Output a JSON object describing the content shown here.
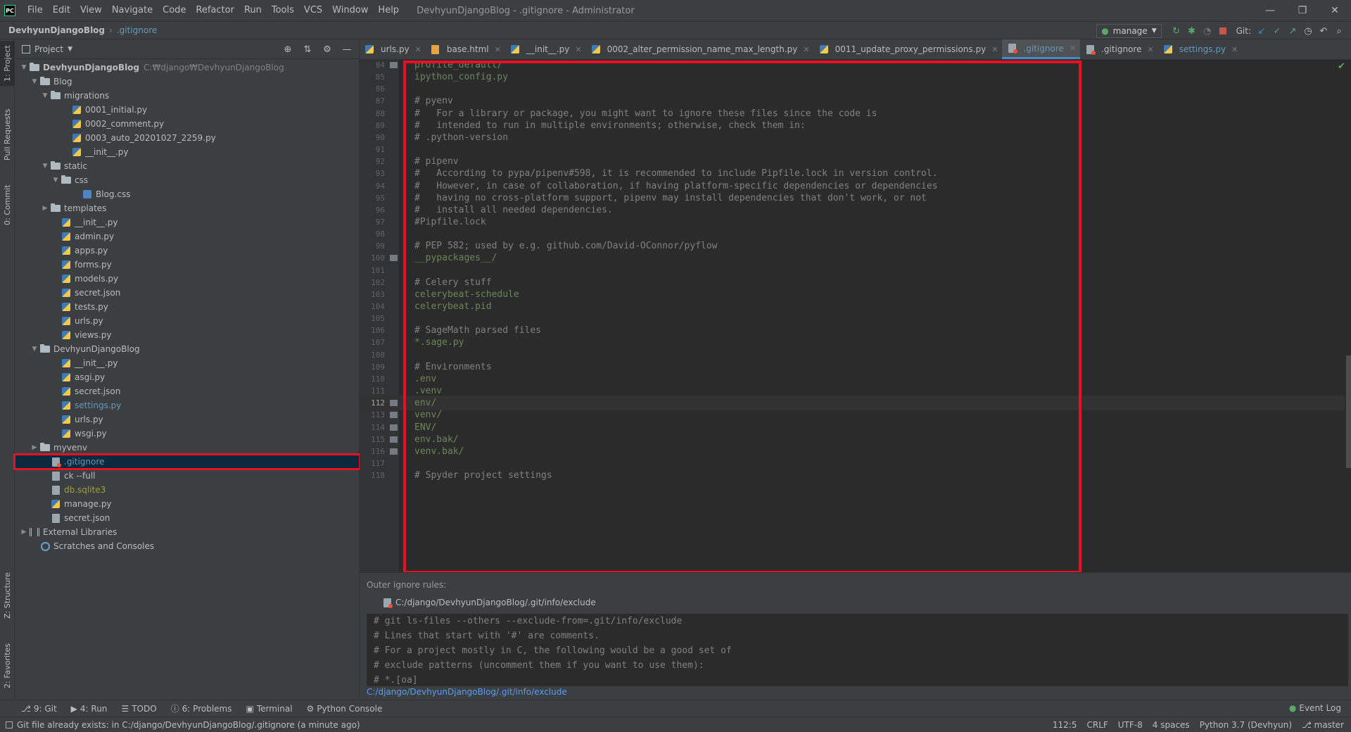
{
  "window": {
    "title": "DevhyunDjangoBlog - .gitignore - Administrator",
    "logo": "PC",
    "menu": [
      "File",
      "Edit",
      "View",
      "Navigate",
      "Code",
      "Refactor",
      "Run",
      "Tools",
      "VCS",
      "Window",
      "Help"
    ],
    "controls": {
      "minimize": "—",
      "restore": "❐",
      "close": "✕"
    }
  },
  "navbar": {
    "root": "DevhyunDjangoBlog",
    "file": ".gitignore",
    "run_config": "manage",
    "git_label": "Git:"
  },
  "left_strip": {
    "tabs": [
      "1: Project",
      "Pull Requests",
      "0: Commit",
      "Z: Structure",
      "2: Favorites"
    ]
  },
  "project_panel": {
    "title": "Project",
    "tree": [
      {
        "label": "DevhyunDjangoBlog",
        "path": "C:₩django₩DevhyunDjangoBlog",
        "kind": "folder",
        "depth": 0,
        "arrow": "▼",
        "style": "bold"
      },
      {
        "label": "Blog",
        "kind": "folder",
        "depth": 1,
        "arrow": "▼"
      },
      {
        "label": "migrations",
        "kind": "folder",
        "depth": 2,
        "arrow": "▼"
      },
      {
        "label": "0001_initial.py",
        "kind": "py",
        "depth": 4
      },
      {
        "label": "0002_comment.py",
        "kind": "py",
        "depth": 4
      },
      {
        "label": "0003_auto_20201027_2259.py",
        "kind": "py",
        "depth": 4
      },
      {
        "label": "__init__.py",
        "kind": "py",
        "depth": 4
      },
      {
        "label": "static",
        "kind": "folder",
        "depth": 2,
        "arrow": "▼"
      },
      {
        "label": "css",
        "kind": "folder",
        "depth": 3,
        "arrow": "▼"
      },
      {
        "label": "Blog.css",
        "kind": "css",
        "depth": 5
      },
      {
        "label": "templates",
        "kind": "folder",
        "depth": 2,
        "arrow": "▶"
      },
      {
        "label": "__init__.py",
        "kind": "py",
        "depth": 3
      },
      {
        "label": "admin.py",
        "kind": "py",
        "depth": 3
      },
      {
        "label": "apps.py",
        "kind": "py",
        "depth": 3
      },
      {
        "label": "forms.py",
        "kind": "py",
        "depth": 3
      },
      {
        "label": "models.py",
        "kind": "py",
        "depth": 3
      },
      {
        "label": "secret.json",
        "kind": "py",
        "depth": 3
      },
      {
        "label": "tests.py",
        "kind": "py",
        "depth": 3
      },
      {
        "label": "urls.py",
        "kind": "py",
        "depth": 3
      },
      {
        "label": "views.py",
        "kind": "py",
        "depth": 3
      },
      {
        "label": "DevhyunDjangoBlog",
        "kind": "folder",
        "depth": 1,
        "arrow": "▼"
      },
      {
        "label": "__init__.py",
        "kind": "py",
        "depth": 3
      },
      {
        "label": "asgi.py",
        "kind": "py",
        "depth": 3
      },
      {
        "label": "secret.json",
        "kind": "py",
        "depth": 3
      },
      {
        "label": "settings.py",
        "kind": "py",
        "depth": 3,
        "style": "blue"
      },
      {
        "label": "urls.py",
        "kind": "py",
        "depth": 3
      },
      {
        "label": "wsgi.py",
        "kind": "py",
        "depth": 3
      },
      {
        "label": "myvenv",
        "kind": "folder",
        "depth": 1,
        "arrow": "▶"
      },
      {
        "label": ".gitignore",
        "kind": "git",
        "depth": 2,
        "selected": true,
        "style": "blue"
      },
      {
        "label": "ck --full",
        "kind": "file",
        "depth": 2
      },
      {
        "label": "db.sqlite3",
        "kind": "file",
        "depth": 2,
        "style": "olive"
      },
      {
        "label": "manage.py",
        "kind": "py",
        "depth": 2
      },
      {
        "label": "secret.json",
        "kind": "file",
        "depth": 2
      },
      {
        "label": "External Libraries",
        "kind": "lib",
        "depth": 0,
        "arrow": "▶"
      },
      {
        "label": "Scratches and Consoles",
        "kind": "scratch",
        "depth": 1
      }
    ]
  },
  "tabs": [
    {
      "label": "urls.py",
      "icon": "py"
    },
    {
      "label": "base.html",
      "icon": "html"
    },
    {
      "label": "__init__.py",
      "icon": "py"
    },
    {
      "label": "0002_alter_permission_name_max_length.py",
      "icon": "py"
    },
    {
      "label": "0011_update_proxy_permissions.py",
      "icon": "py"
    },
    {
      "label": ".gitignore",
      "icon": "git",
      "active": true,
      "style": "blue"
    },
    {
      "label": ".gitignore",
      "icon": "git"
    },
    {
      "label": "settings.py",
      "icon": "py",
      "style": "blue"
    }
  ],
  "editor": {
    "cursor_line": "112",
    "lines": [
      {
        "n": "84",
        "text": "profile_default/",
        "kind": "path",
        "fold": true
      },
      {
        "n": "85",
        "text": "ipython_config.py",
        "kind": "path"
      },
      {
        "n": "86",
        "text": "",
        "kind": "path"
      },
      {
        "n": "87",
        "text": "# pyenv",
        "kind": "comment"
      },
      {
        "n": "88",
        "text": "#   For a library or package, you might want to ignore these files since the code is",
        "kind": "comment"
      },
      {
        "n": "89",
        "text": "#   intended to run in multiple environments; otherwise, check them in:",
        "kind": "comment"
      },
      {
        "n": "90",
        "text": "# .python-version",
        "kind": "comment"
      },
      {
        "n": "91",
        "text": "",
        "kind": "path"
      },
      {
        "n": "92",
        "text": "# pipenv",
        "kind": "comment"
      },
      {
        "n": "93",
        "text": "#   According to pypa/pipenv#598, it is recommended to include Pipfile.lock in version control.",
        "kind": "comment"
      },
      {
        "n": "94",
        "text": "#   However, in case of collaboration, if having platform-specific dependencies or dependencies",
        "kind": "comment"
      },
      {
        "n": "95",
        "text": "#   having no cross-platform support, pipenv may install dependencies that don't work, or not",
        "kind": "comment"
      },
      {
        "n": "96",
        "text": "#   install all needed dependencies.",
        "kind": "comment"
      },
      {
        "n": "97",
        "text": "#Pipfile.lock",
        "kind": "comment"
      },
      {
        "n": "98",
        "text": "",
        "kind": "path"
      },
      {
        "n": "99",
        "text": "# PEP 582; used by e.g. github.com/David-OConnor/pyflow",
        "kind": "comment"
      },
      {
        "n": "100",
        "text": "__pypackages__/",
        "kind": "path",
        "fold": true
      },
      {
        "n": "101",
        "text": "",
        "kind": "path"
      },
      {
        "n": "102",
        "text": "# Celery stuff",
        "kind": "comment"
      },
      {
        "n": "103",
        "text": "celerybeat-schedule",
        "kind": "path"
      },
      {
        "n": "104",
        "text": "celerybeat.pid",
        "kind": "path"
      },
      {
        "n": "105",
        "text": "",
        "kind": "path"
      },
      {
        "n": "106",
        "text": "# SageMath parsed files",
        "kind": "comment"
      },
      {
        "n": "107",
        "text": "*.sage.py",
        "kind": "path"
      },
      {
        "n": "108",
        "text": "",
        "kind": "path"
      },
      {
        "n": "109",
        "text": "# Environments",
        "kind": "comment"
      },
      {
        "n": "110",
        "text": ".env",
        "kind": "path"
      },
      {
        "n": "111",
        "text": ".venv",
        "kind": "path"
      },
      {
        "n": "112",
        "text": "env/",
        "kind": "path",
        "fold": true,
        "cursor": true
      },
      {
        "n": "113",
        "text": "venv/",
        "kind": "path",
        "fold": true
      },
      {
        "n": "114",
        "text": "ENV/",
        "kind": "path",
        "fold": true
      },
      {
        "n": "115",
        "text": "env.bak/",
        "kind": "path",
        "fold": true
      },
      {
        "n": "116",
        "text": "venv.bak/",
        "kind": "path",
        "fold": true
      },
      {
        "n": "117",
        "text": "",
        "kind": "path"
      },
      {
        "n": "118",
        "text": "# Spyder project settings",
        "kind": "comment"
      }
    ]
  },
  "outer_rules": {
    "title": "Outer ignore rules:",
    "file": "C:/django/DevhyunDjangoBlog/.git/info/exclude",
    "lines": [
      "# git ls-files --others --exclude-from=.git/info/exclude",
      "# Lines that start with '#' are comments.",
      "# For a project mostly in C, the following would be a good set of",
      "# exclude patterns (uncomment them if you want to use them):",
      "# *.[oa]"
    ],
    "link": "C:/django/DevhyunDjangoBlog/.git/info/exclude"
  },
  "bottom_tools": [
    {
      "label": "9: Git",
      "icon": "⎇"
    },
    {
      "label": "4: Run",
      "icon": "▶"
    },
    {
      "label": "TODO",
      "icon": "☰"
    },
    {
      "label": "6: Problems",
      "icon": "ⓘ"
    },
    {
      "label": "Terminal",
      "icon": "▣"
    },
    {
      "label": "Python Console",
      "icon": "⚙"
    }
  ],
  "event_log": "Event Log",
  "status": {
    "message": "Git file already exists: in C:/django/DevhyunDjangoBlog/.gitignore (a minute ago)",
    "position": "112:5",
    "line_sep": "CRLF",
    "encoding": "UTF-8",
    "indent": "4 spaces",
    "interpreter": "Python 3.7 (Devhyun)",
    "branch": "master"
  }
}
